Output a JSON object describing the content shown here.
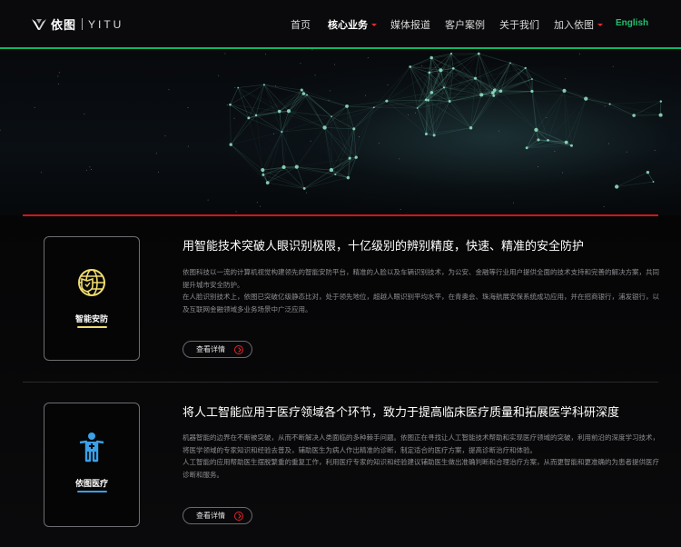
{
  "header": {
    "logo_cn": "依图",
    "logo_en": "YITU",
    "nav": [
      {
        "label": "首页",
        "active": false,
        "dropdown": false
      },
      {
        "label": "核心业务",
        "active": true,
        "dropdown": true
      },
      {
        "label": "媒体报道",
        "active": false,
        "dropdown": false
      },
      {
        "label": "客户案例",
        "active": false,
        "dropdown": false
      },
      {
        "label": "关于我们",
        "active": false,
        "dropdown": false
      },
      {
        "label": "加入依图",
        "active": false,
        "dropdown": true
      },
      {
        "label": "English",
        "active": false,
        "dropdown": false
      }
    ]
  },
  "colors": {
    "accent_green": "#0fb66b",
    "accent_red": "#d3141c",
    "security_yellow": "#f0dc6e",
    "medical_blue": "#3aa0e8"
  },
  "sections": [
    {
      "card_label": "智能安防",
      "icon": "globe-shield-icon",
      "title": "用智能技术突破人眼识别极限，十亿级别的辨别精度，快速、精准的安全防护",
      "paragraphs": [
        "依图科技以一流的计算机视觉构建领先的智能安防平台，精准的人脸以及车辆识别技术，为公安、金融等行业用户提供全面的技术支持和完善的解决方案，共同提升城市安全防护。",
        "在人脸识别技术上，依图已突破亿级静态比对，处于领先地位，超越人眼识别平均水平，在青奥会、珠海航展安保系统成功应用，并在招商银行，浦发银行，以及互联网金融领域多业务场景中广泛应用。"
      ],
      "more_label": "查看详情"
    },
    {
      "card_label": "依图医疗",
      "icon": "medical-person-icon",
      "title": "将人工智能应用于医疗领域各个环节，致力于提高临床医疗质量和拓展医学科研深度",
      "paragraphs": [
        "机器智能的边界在不断被突破，从而不断解决人类面临的多种棘手问题。依图正在寻找让人工智能技术帮助和实现医疗领域的突破，利用前沿的深度学习技术，将医学领域的专家知识和经验去普及，辅助医生为病人作出精准的诊断，制定适合的医疗方案，提高诊断治疗和体验。",
        "人工智能的应用帮助医生摆脱繁重的重复工作，利用医疗专家的知识和经验建议辅助医生做出准确判断和合理治疗方案，从而更智能和更准确的为患者提供医疗诊断和服务。"
      ],
      "more_label": "查看详情"
    }
  ]
}
